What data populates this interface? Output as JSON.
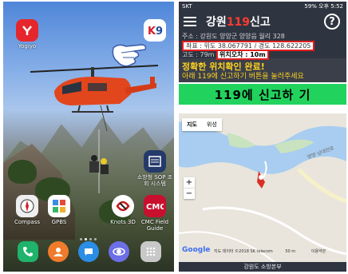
{
  "left_phone": {
    "carrier": "",
    "apps": [
      {
        "label": "Yogiyo",
        "icon": "yogiyo-icon",
        "color": "#e5272d"
      },
      {
        "label": "",
        "icon": "k9-icon",
        "color": "#ffffff"
      },
      {
        "label": "소방청 SOP 조회 시스템",
        "icon": "sop-icon",
        "color": "#243a6a"
      },
      {
        "label": "Compass",
        "icon": "compass-icon",
        "color": "#eeeeee"
      },
      {
        "label": "GPBS",
        "icon": "gpbs-icon",
        "color": "#ffffff"
      },
      {
        "label": "Knots 3D",
        "icon": "knots-icon",
        "color": "#ffffff"
      },
      {
        "label": "CMC Field Guide",
        "icon": "cmc-icon",
        "color": "#c8102e"
      }
    ],
    "dock": [
      {
        "icon": "phone-icon",
        "color": "#1fb36b"
      },
      {
        "icon": "contacts-icon",
        "color": "#f07b2b"
      },
      {
        "icon": "messages-icon",
        "color": "#2a8de6"
      },
      {
        "icon": "internet-icon",
        "color": "#6c6fe6"
      },
      {
        "icon": "apps-drawer-icon",
        "color": "#cccccc"
      }
    ]
  },
  "right_phone": {
    "status": {
      "carrier": "SKT",
      "right": "59% 오후 5:52"
    },
    "app_title_prefix": "강원",
    "app_title_number": "119",
    "app_title_suffix": "신고",
    "help_label": "?",
    "address": "주소 : 강원도 양양군 양양읍 월리 328",
    "coords": "좌표 : 위도 38.067791 / 경도 128.622205",
    "altitude": "고도 : 79m",
    "error": "위치오차 : 10m",
    "confirm": "정확한 위치확인 완료!",
    "instruction": "아래 119에 신고하기 버튼을 눌러주세요",
    "call_button": "119에 신고하 기",
    "map": {
      "tab_map": "지도",
      "tab_satellite": "위성",
      "zoom_in": "+",
      "zoom_out": "−",
      "google": "Google",
      "attribution": "지도 데이터 ©2018 SK telecom",
      "scale": "50 m",
      "terms": "이용약관",
      "road_label": "양양 남대천로"
    },
    "footer": "강원도 소방본부"
  },
  "colors": {
    "accent_red": "#e02020",
    "call_green": "#21d35d",
    "bar_dark": "#2f3441",
    "yellow": "#ffd21f"
  }
}
